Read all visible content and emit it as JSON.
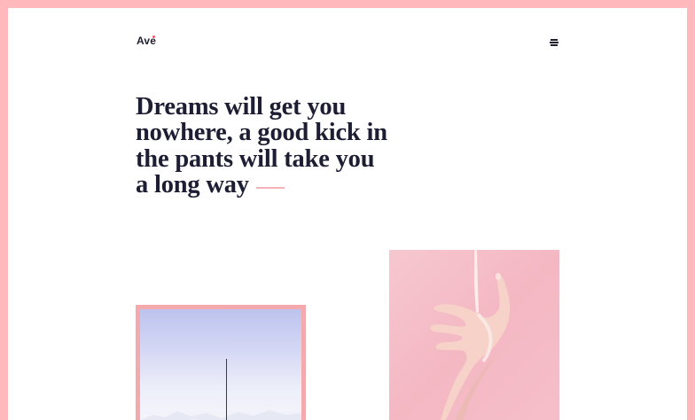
{
  "brand": {
    "logo_text": "Ave",
    "accent_color": "#f35b6a"
  },
  "header": {
    "menu_icon": "hamburger-menu-icon"
  },
  "hero": {
    "headline_line1": "Dreams will get you",
    "headline_line2": "nowhere, a good kick in",
    "headline_line3": "the pants will take you",
    "headline_line4": "a long way"
  },
  "gallery": {
    "items": [
      {
        "subject": "sky-mast-photo"
      },
      {
        "subject": "hand-milk-photo"
      }
    ]
  },
  "colors": {
    "frame": "#ffb9bc",
    "text_dark": "#1d1d33",
    "dash": "#f4b1b8"
  }
}
